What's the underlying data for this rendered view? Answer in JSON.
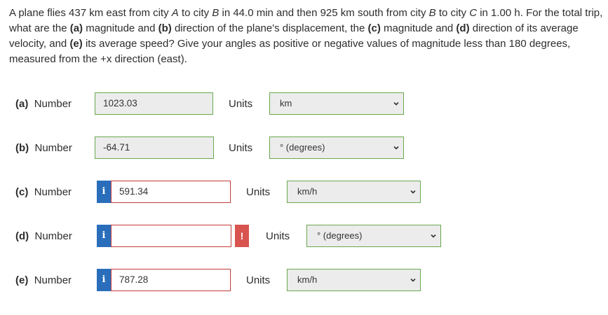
{
  "question": {
    "s1": "A plane flies 437 km east from city ",
    "cityA": "A",
    "s2": " to city ",
    "cityB": "B",
    "s3": " in 44.0 min and then 925 km south from city ",
    "cityB2": "B",
    "s4": " to city ",
    "cityC": "C",
    "s5": " in 1.00 h. For the total trip, what are the ",
    "a": "(a)",
    "s6": " magnitude and ",
    "b": "(b)",
    "s7": " direction of the plane's displacement, the ",
    "c": "(c)",
    "s8": " magnitude and ",
    "d": "(d)",
    "s9": " direction of its average velocity, and ",
    "e": "(e)",
    "s10": " its average speed? Give your angles as positive or negative values of magnitude less than 180 degrees, measured from the +x direction (east)."
  },
  "number_label": "Number",
  "units_label": "Units",
  "info_glyph": "i",
  "error_glyph": "!",
  "rows": [
    {
      "part": "(a)",
      "value": "1023.03",
      "units": "km"
    },
    {
      "part": "(b)",
      "value": "-64.71",
      "units": "° (degrees)"
    },
    {
      "part": "(c)",
      "value": "591.34",
      "units": "km/h"
    },
    {
      "part": "(d)",
      "value": "",
      "units": "° (degrees)"
    },
    {
      "part": "(e)",
      "value": "787.28",
      "units": "km/h"
    }
  ],
  "colors": {
    "correct_border": "#6aa84f",
    "incorrect_border": "#c43b3b",
    "info_badge": "#2a6ebb",
    "error_badge": "#d9534f"
  }
}
